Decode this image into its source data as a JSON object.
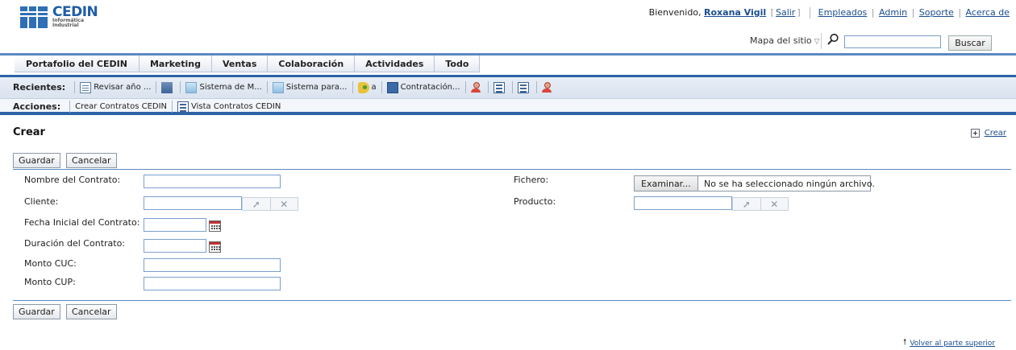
{
  "brand": {
    "name": "CEDIN",
    "sub_line1": "Informática",
    "sub_line2": "Industrial"
  },
  "header": {
    "welcome": "Bienvenido,",
    "user_name": "Roxana Vigil",
    "logout": "Salir",
    "links": [
      "Empleados",
      "Admin",
      "Soporte",
      "Acerca de"
    ],
    "sitemap": "Mapa del sitio",
    "search_button": "Buscar",
    "search_value": ""
  },
  "nav": {
    "tabs": [
      "Portafolio del CEDIN",
      "Marketing",
      "Ventas",
      "Colaboración",
      "Actividades",
      "Todo"
    ]
  },
  "recent": {
    "label": "Recientes:",
    "items": [
      {
        "icon": "document-icon",
        "label": "Revisar año ..."
      },
      {
        "icon": "building-icon",
        "label": ""
      },
      {
        "icon": "system-icon",
        "label": "Sistema de M..."
      },
      {
        "icon": "system-icon",
        "label": "Sistema para..."
      },
      {
        "icon": "tag-icon",
        "label": "a"
      },
      {
        "icon": "contract-icon",
        "label": "Contratación..."
      },
      {
        "icon": "user-icon",
        "label": ""
      },
      {
        "icon": "list-icon",
        "label": ""
      },
      {
        "icon": "list-icon",
        "label": ""
      },
      {
        "icon": "user-icon",
        "label": ""
      }
    ]
  },
  "actions": {
    "label": "Acciones:",
    "items": [
      "Crear Contratos CEDIN",
      "Vista Contratos CEDIN"
    ]
  },
  "page": {
    "title": "Crear",
    "create_link": "Crear",
    "save": "Guardar",
    "cancel": "Cancelar",
    "back_to_top": "Volver al parte superior"
  },
  "form": {
    "nombre_label": "Nombre del Contrato:",
    "cliente_label": "Cliente:",
    "fecha_label": "Fecha Inicial del Contrato:",
    "duracion_label": "Duración del Contrato:",
    "monto_cuc_label": "Monto CUC:",
    "monto_cup_label": "Monto CUP:",
    "fichero_label": "Fichero:",
    "producto_label": "Producto:",
    "file_button": "Examinar...",
    "file_status": "No se ha seleccionado ningún archivo."
  },
  "colors": {
    "accent": "#2c63a7",
    "link": "#1a4d8f"
  }
}
